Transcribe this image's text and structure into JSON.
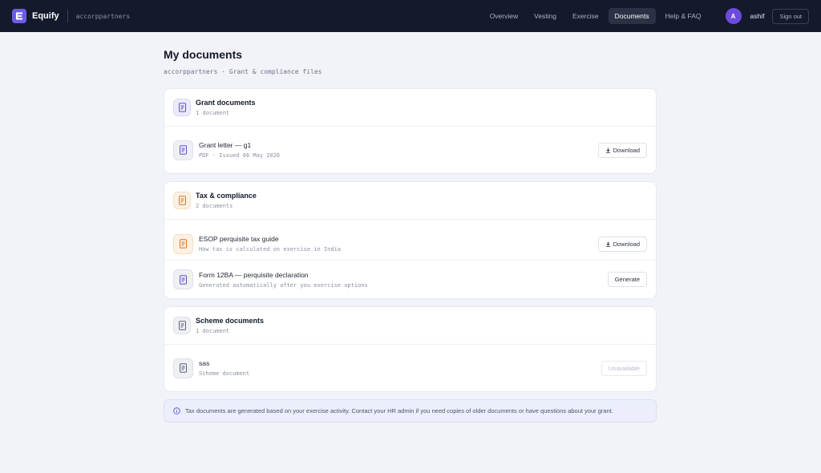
{
  "app": {
    "brand": "Equify",
    "org": "accorppartners",
    "colors": {
      "nav_bg": "#141a2b",
      "accent": "#6d5ce8",
      "page_bg": "#f1f3f8"
    }
  },
  "nav": {
    "items": [
      {
        "label": "Overview"
      },
      {
        "label": "Vesting"
      },
      {
        "label": "Exercise"
      },
      {
        "label": "Documents",
        "active": true
      },
      {
        "label": "Help & FAQ"
      }
    ],
    "user": {
      "initial": "A",
      "name": "ashif"
    },
    "signout_label": "Sign out"
  },
  "page": {
    "title": "My documents",
    "subtitle": "accorppartners · Grant & compliance files"
  },
  "sections": [
    {
      "title": "Grant documents",
      "count": "1 document",
      "icon": "document-icon",
      "rows": [
        {
          "title": "Grant letter — g1",
          "sub": "PDF · Issued 06 May 2026",
          "action": "Download",
          "icon": "document-icon"
        }
      ]
    },
    {
      "title": "Tax & compliance",
      "count": "2 documents",
      "icon": "tax-document-icon",
      "rows": [
        {
          "title": "ESOP perquisite tax guide",
          "sub": "How tax is calculated on exercise in India",
          "action": "Download",
          "icon": "tax-document-icon"
        },
        {
          "title": "Form 12BA — perquisite declaration",
          "sub": "Generated automatically after you exercise options",
          "action": "Generate",
          "icon": "document-icon"
        }
      ]
    },
    {
      "title": "Scheme documents",
      "count": "1 document",
      "icon": "document-icon",
      "rows": [
        {
          "title": "sas",
          "sub": "Scheme document",
          "action": "Unavailable",
          "icon": "document-icon"
        }
      ]
    }
  ],
  "notice": {
    "text": "Tax documents are generated based on your exercise activity. Contact your HR admin if you need copies of older documents or have questions about your grant."
  }
}
